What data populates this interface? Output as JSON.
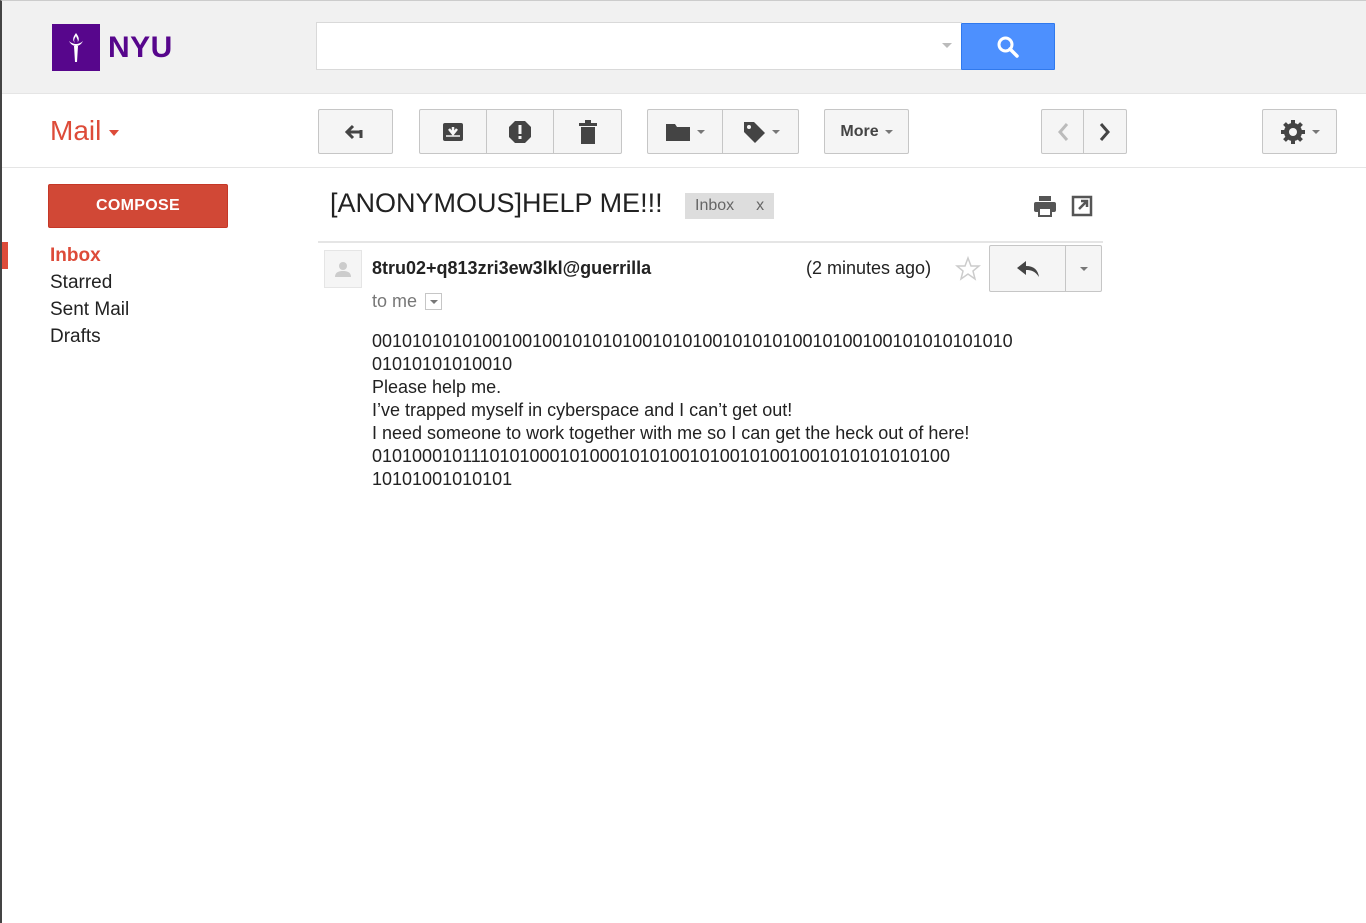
{
  "header": {
    "logo_text": "NYU",
    "search": {
      "value": "",
      "placeholder": ""
    },
    "brand_color": "#57068c",
    "search_button_color": "#4d90fe"
  },
  "toolbar": {
    "app_label": "Mail",
    "more_label": "More",
    "icons": [
      "back-arrow-icon",
      "archive-icon",
      "report-spam-icon",
      "delete-icon",
      "move-to-folder-icon",
      "labels-icon",
      "older-chevron-icon",
      "newer-chevron-icon",
      "settings-gear-icon"
    ]
  },
  "sidebar": {
    "compose_label": "COMPOSE",
    "compose_color": "#d14836",
    "items": [
      {
        "label": "Inbox",
        "active": true
      },
      {
        "label": "Starred",
        "active": false
      },
      {
        "label": "Sent Mail",
        "active": false
      },
      {
        "label": "Drafts",
        "active": false
      }
    ]
  },
  "message": {
    "subject": "[ANONYMOUS]HELP ME!!!",
    "label_chip": "Inbox",
    "label_remove": "x",
    "sender": "8tru02+q813zri3ew3lkl@guerrilla",
    "time": "(2 minutes ago)",
    "recipient": "to me",
    "body_lines": [
      "0010101010100100100101010100101010010101010010100100101010101010",
      "01010101010010",
      "Please help me.",
      "I’ve trapped myself in cyberspace and I can’t get out!",
      "I need someone to work together with me so I can get the heck out of here!",
      "0101000101110101000101000101010010100101001001010101010100",
      "10101001010101"
    ]
  }
}
